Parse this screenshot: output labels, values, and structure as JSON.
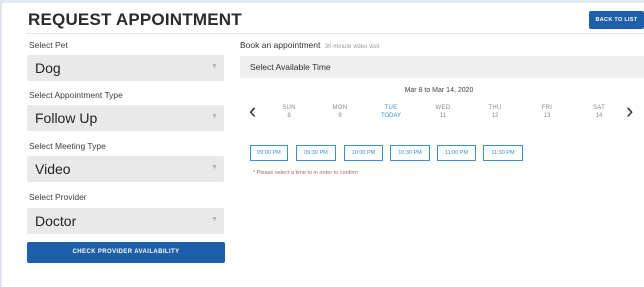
{
  "header": {
    "title": "REQUEST APPOINTMENT",
    "back_button": "BACK TO LIST"
  },
  "form": {
    "pet": {
      "label": "Select Pet",
      "value": "Dog"
    },
    "appointment_type": {
      "label": "Select Appointment Type",
      "value": "Follow Up"
    },
    "meeting_type": {
      "label": "Select Meeting Type",
      "value": "Video"
    },
    "provider": {
      "label": "Select Provider",
      "value": "Doctor"
    },
    "check_button": "CHECK PROVIDER AVAILABILITY"
  },
  "booking": {
    "title": "Book an appointment",
    "subtitle": "30-minute video visit",
    "available_time_label": "Select Available Time",
    "date_range": "Mar 8 to Mar 14, 2020",
    "days": [
      {
        "name": "SUN",
        "date": "8"
      },
      {
        "name": "MON",
        "date": "9"
      },
      {
        "name": "TUE",
        "date": "TODAY",
        "selected": true
      },
      {
        "name": "WED",
        "date": "11"
      },
      {
        "name": "THU",
        "date": "12"
      },
      {
        "name": "FRI",
        "date": "13"
      },
      {
        "name": "SAT",
        "date": "14"
      }
    ],
    "time_slots": [
      "09:00 PM",
      "09:30 PM",
      "10:00 PM",
      "10:30 PM",
      "11:00 PM",
      "11:30 PM"
    ],
    "note": "* Please select a time to in order to confirm"
  },
  "colors": {
    "primary_button": "#1d5fa8",
    "accent": "#3a8fd6",
    "select_bg": "#e9e9e9"
  }
}
